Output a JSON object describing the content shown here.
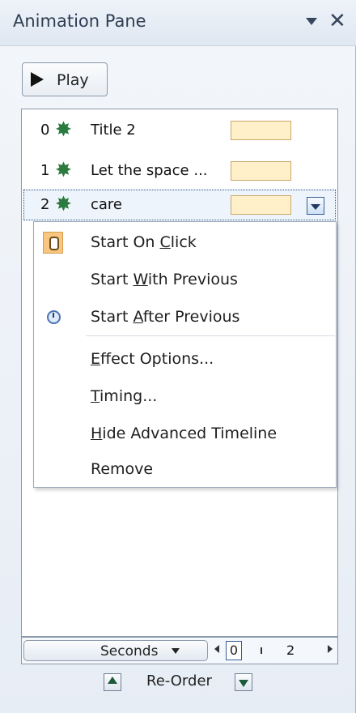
{
  "pane": {
    "title": "Animation Pane",
    "dropdown_icon": "triangle-down-icon",
    "close_glyph": "✕"
  },
  "toolbar": {
    "play_label": "Play"
  },
  "items": [
    {
      "num": "0",
      "label": "Title 2",
      "icon": "star-burst-icon"
    },
    {
      "num": "1",
      "label": "Let the space ...",
      "icon": "star-burst-icon"
    },
    {
      "num": "2",
      "label": "care",
      "icon": "star-burst-icon",
      "selected": true
    }
  ],
  "menu": {
    "start_on_click": {
      "before": "Start On ",
      "key": "C",
      "after": "lick"
    },
    "start_with_previous": {
      "before": "Start ",
      "key": "W",
      "after": "ith Previous"
    },
    "start_after_previous": {
      "before": "Start ",
      "key": "A",
      "after": "fter Previous"
    },
    "effect_options": {
      "before": "",
      "key": "E",
      "after": "ffect Options..."
    },
    "timing": {
      "before": "",
      "key": "T",
      "after": "iming..."
    },
    "hide_advanced_timeline": {
      "before": "",
      "key": "H",
      "after": "ide Advanced Timeline"
    },
    "remove": {
      "label": "Remove"
    }
  },
  "timeline": {
    "seconds_label": "Seconds",
    "tick_zero": "0",
    "tick_two": "2"
  },
  "reorder": {
    "label": "Re-Order"
  },
  "colors": {
    "bar_fill": "#fff0c9",
    "star": "#2b7a3f",
    "selection": "#3b5f91"
  }
}
